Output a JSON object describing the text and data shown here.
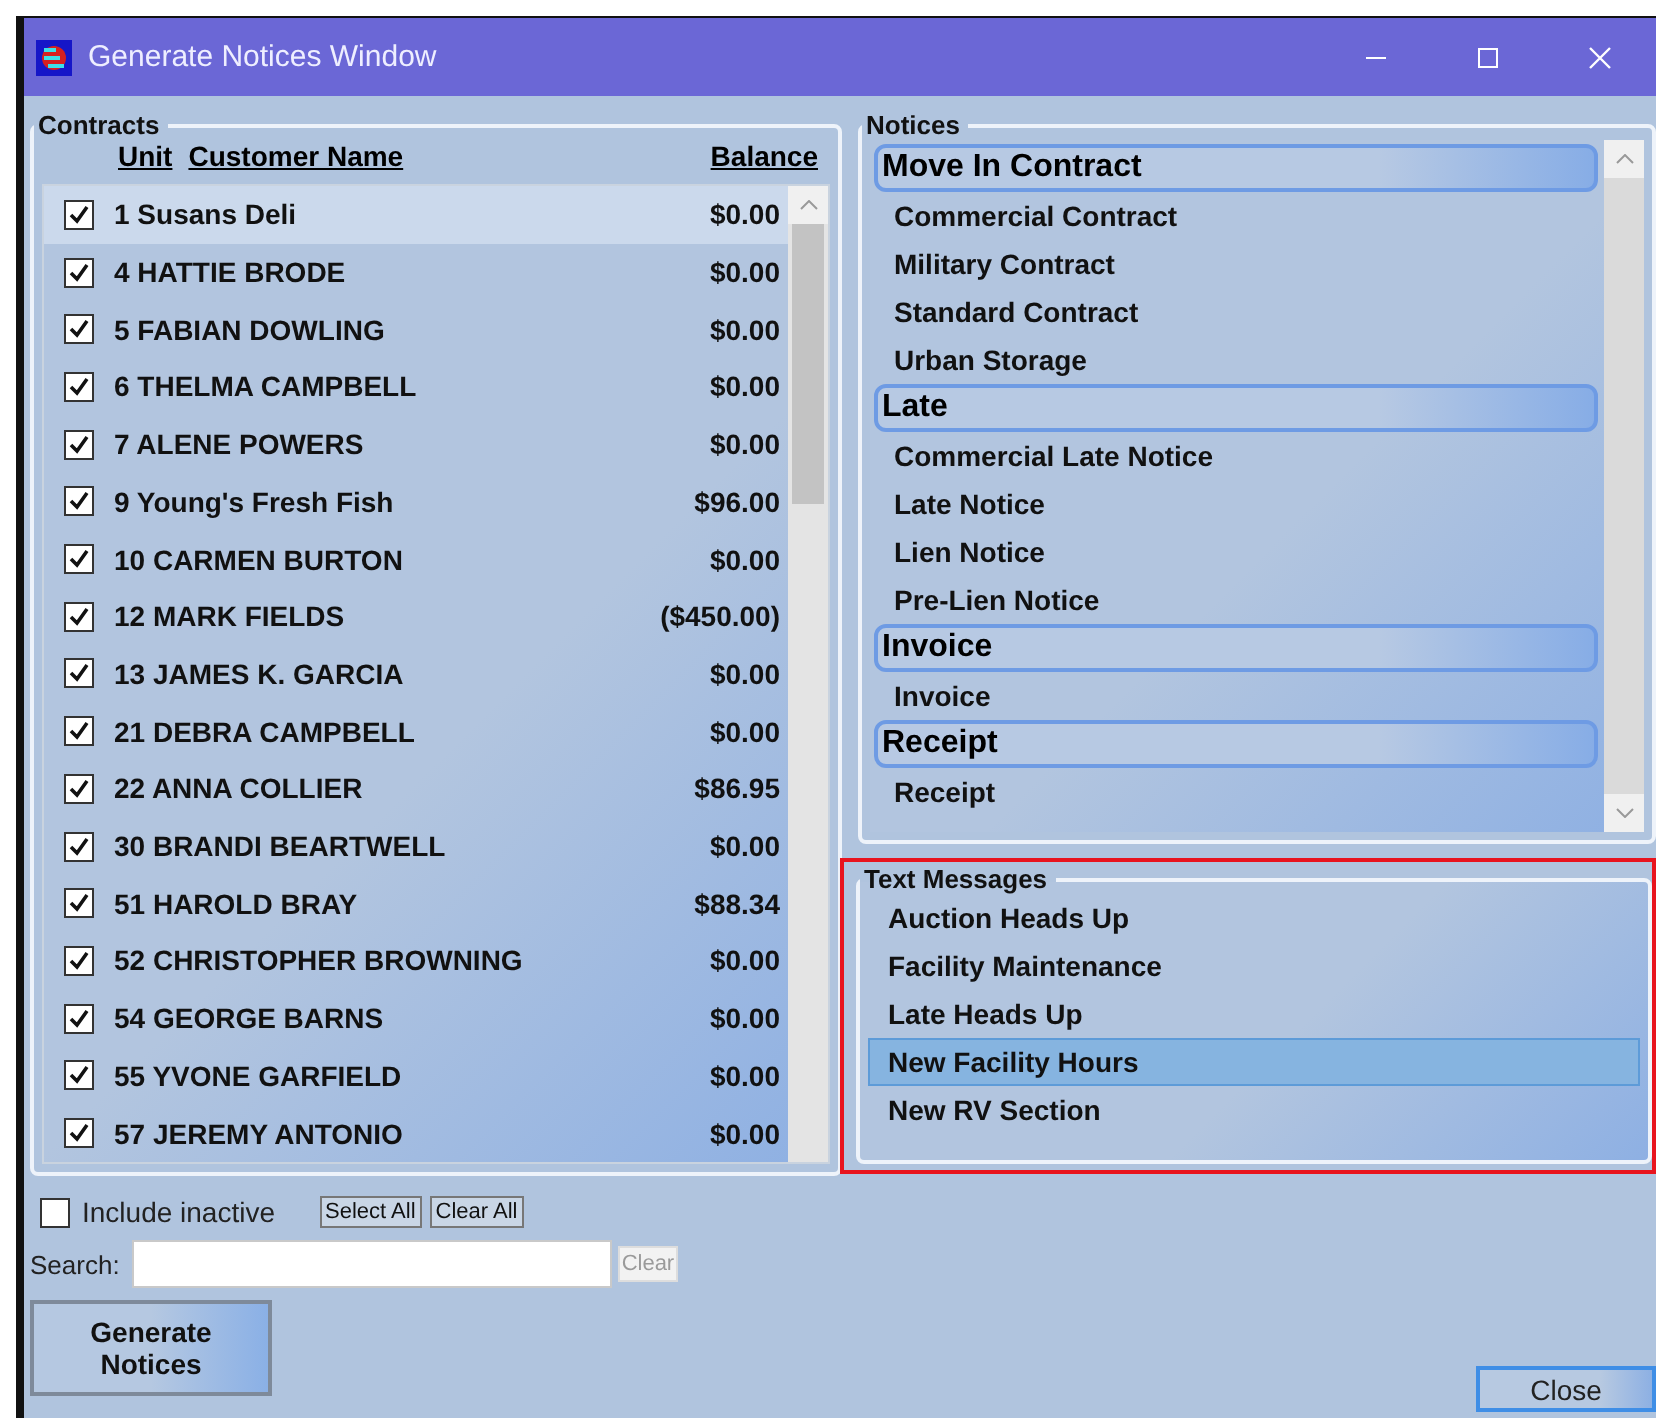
{
  "window": {
    "title": "Generate Notices Window"
  },
  "contracts": {
    "legend": "Contracts",
    "columns": [
      "Unit",
      "Customer Name",
      "Balance"
    ],
    "rows": [
      {
        "unit": "1",
        "name": "Susans Deli",
        "balance": "$0.00",
        "checked": true,
        "selected": true
      },
      {
        "unit": "4",
        "name": "HATTIE BRODE",
        "balance": "$0.00",
        "checked": true,
        "selected": false
      },
      {
        "unit": "5",
        "name": "FABIAN DOWLING",
        "balance": "$0.00",
        "checked": true,
        "selected": false
      },
      {
        "unit": "6",
        "name": "THELMA CAMPBELL",
        "balance": "$0.00",
        "checked": true,
        "selected": false
      },
      {
        "unit": "7",
        "name": "ALENE POWERS",
        "balance": "$0.00",
        "checked": true,
        "selected": false
      },
      {
        "unit": "9",
        "name": "Young's Fresh Fish",
        "balance": "$96.00",
        "checked": true,
        "selected": false
      },
      {
        "unit": "10",
        "name": "CARMEN BURTON",
        "balance": "$0.00",
        "checked": true,
        "selected": false
      },
      {
        "unit": "12",
        "name": "MARK FIELDS",
        "balance": "($450.00)",
        "checked": true,
        "selected": false
      },
      {
        "unit": "13",
        "name": "JAMES K. GARCIA",
        "balance": "$0.00",
        "checked": true,
        "selected": false
      },
      {
        "unit": "21",
        "name": "DEBRA CAMPBELL",
        "balance": "$0.00",
        "checked": true,
        "selected": false
      },
      {
        "unit": "22",
        "name": "ANNA COLLIER",
        "balance": "$86.95",
        "checked": true,
        "selected": false
      },
      {
        "unit": "30",
        "name": "BRANDI BEARTWELL",
        "balance": "$0.00",
        "checked": true,
        "selected": false
      },
      {
        "unit": "51",
        "name": "HAROLD BRAY",
        "balance": "$88.34",
        "checked": true,
        "selected": false
      },
      {
        "unit": "52",
        "name": "CHRISTOPHER BROWNING",
        "balance": "$0.00",
        "checked": true,
        "selected": false
      },
      {
        "unit": "54",
        "name": "GEORGE BARNS",
        "balance": "$0.00",
        "checked": true,
        "selected": false
      },
      {
        "unit": "55",
        "name": "YVONE GARFIELD",
        "balance": "$0.00",
        "checked": true,
        "selected": false
      },
      {
        "unit": "57",
        "name": "JEREMY ANTONIO",
        "balance": "$0.00",
        "checked": true,
        "selected": false
      }
    ],
    "include_inactive": {
      "label": "Include inactive",
      "checked": false
    },
    "select_all": "Select All",
    "clear_all": "Clear All",
    "search": {
      "label": "Search:",
      "clear": "Clear",
      "clear_disabled": true
    },
    "generate": "Generate Notices"
  },
  "notices": {
    "legend": "Notices",
    "groups": [
      {
        "heading": "Move In Contract",
        "items": [
          "Commercial Contract",
          "Military Contract",
          "Standard Contract",
          "Urban Storage"
        ]
      },
      {
        "heading": "Late",
        "items": [
          "Commercial Late Notice",
          "Late Notice",
          "Lien Notice",
          "Pre-Lien Notice"
        ]
      },
      {
        "heading": "Invoice",
        "items": [
          "Invoice"
        ]
      },
      {
        "heading": "Receipt",
        "items": [
          "Receipt"
        ]
      }
    ]
  },
  "text_messages": {
    "legend": "Text Messages",
    "items": [
      {
        "label": "Auction Heads Up",
        "selected": false
      },
      {
        "label": "Facility Maintenance",
        "selected": false
      },
      {
        "label": "Late Heads Up",
        "selected": false
      },
      {
        "label": "New Facility Hours",
        "selected": true
      },
      {
        "label": "New RV Section",
        "selected": false
      }
    ]
  },
  "close": "Close"
}
